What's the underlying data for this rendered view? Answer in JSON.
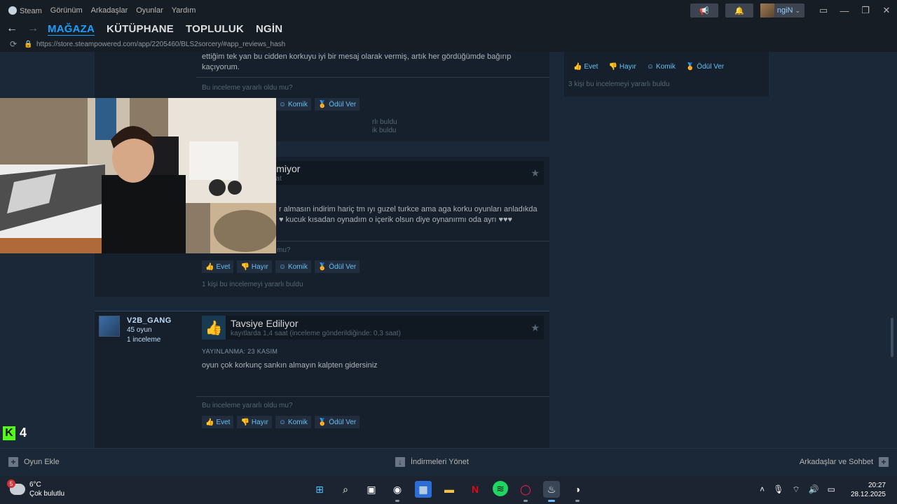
{
  "titlebar": {
    "menu": [
      "Steam",
      "Görünüm",
      "Arkadaşlar",
      "Oyunlar",
      "Yardım"
    ],
    "username": "ngiN"
  },
  "nav": {
    "tabs": [
      "MAĞAZA",
      "KÜTÜPHANE",
      "TOPLULUK",
      "NGİN"
    ],
    "active_tab": "MAĞAZA"
  },
  "url": "https://store.steampowered.com/app/2205460/BLS2sorcery/#app_reviews_hash",
  "reviews": {
    "top_partial": {
      "body": "ettiğim tek yan bu cidden korkuyu iyi bir mesaj olarak vermiş, artık her gördüğümde bağırıp kaçıyorum.",
      "helpful_question": "Bu inceleme yararlı oldu mu?",
      "found_line1": "rlı buldu",
      "found_line2": "ik buldu"
    },
    "middle": {
      "title_partial": "ilmiyor",
      "hours_partial": "aat",
      "body_line1": "r almasın indirim hariç tm ıyı guzel turkce ama aga korku oyunları anladıkda",
      "body_line2": "♥ kucuk kısadan oynadım o içerik olsun diye oynanırmı oda ayrı ♥♥♥",
      "helpful_question_partial": "mu?",
      "found": "1 kişi bu incelemeyi yararlı buldu"
    },
    "bottom": {
      "author": "V2B_GANG",
      "games": "45 oyun",
      "reviews": "1 inceleme",
      "title": "Tavsiye Ediliyor",
      "hours": "kayıtlarda 1,4 saat (inceleme gönderildiğinde: 0,3 saat)",
      "posted": "YAYINLANMA: 23 KASIM",
      "body": "oyun çok korkunç sankın almayın kalpten gidersiniz",
      "helpful_question": "Bu inceleme yararlı oldu mu?"
    },
    "side": {
      "found": "3 kişi bu incelemeyi yararlı buldu"
    },
    "vote": {
      "yes": "Evet",
      "no": "Hayır",
      "funny": "Komik",
      "award": "Ödül Ver"
    }
  },
  "overlay": {
    "k4_number": "4",
    "k_letter": "K"
  },
  "bottombar": {
    "add_game": "Oyun Ekle",
    "downloads": "İndirmeleri Yönet",
    "friends": "Arkadaşlar ve Sohbet"
  },
  "taskbar": {
    "temp": "6°C",
    "weather": "Çok bulutlu",
    "weather_badge": "5",
    "time": "20:27",
    "date": "28.12.2025"
  }
}
